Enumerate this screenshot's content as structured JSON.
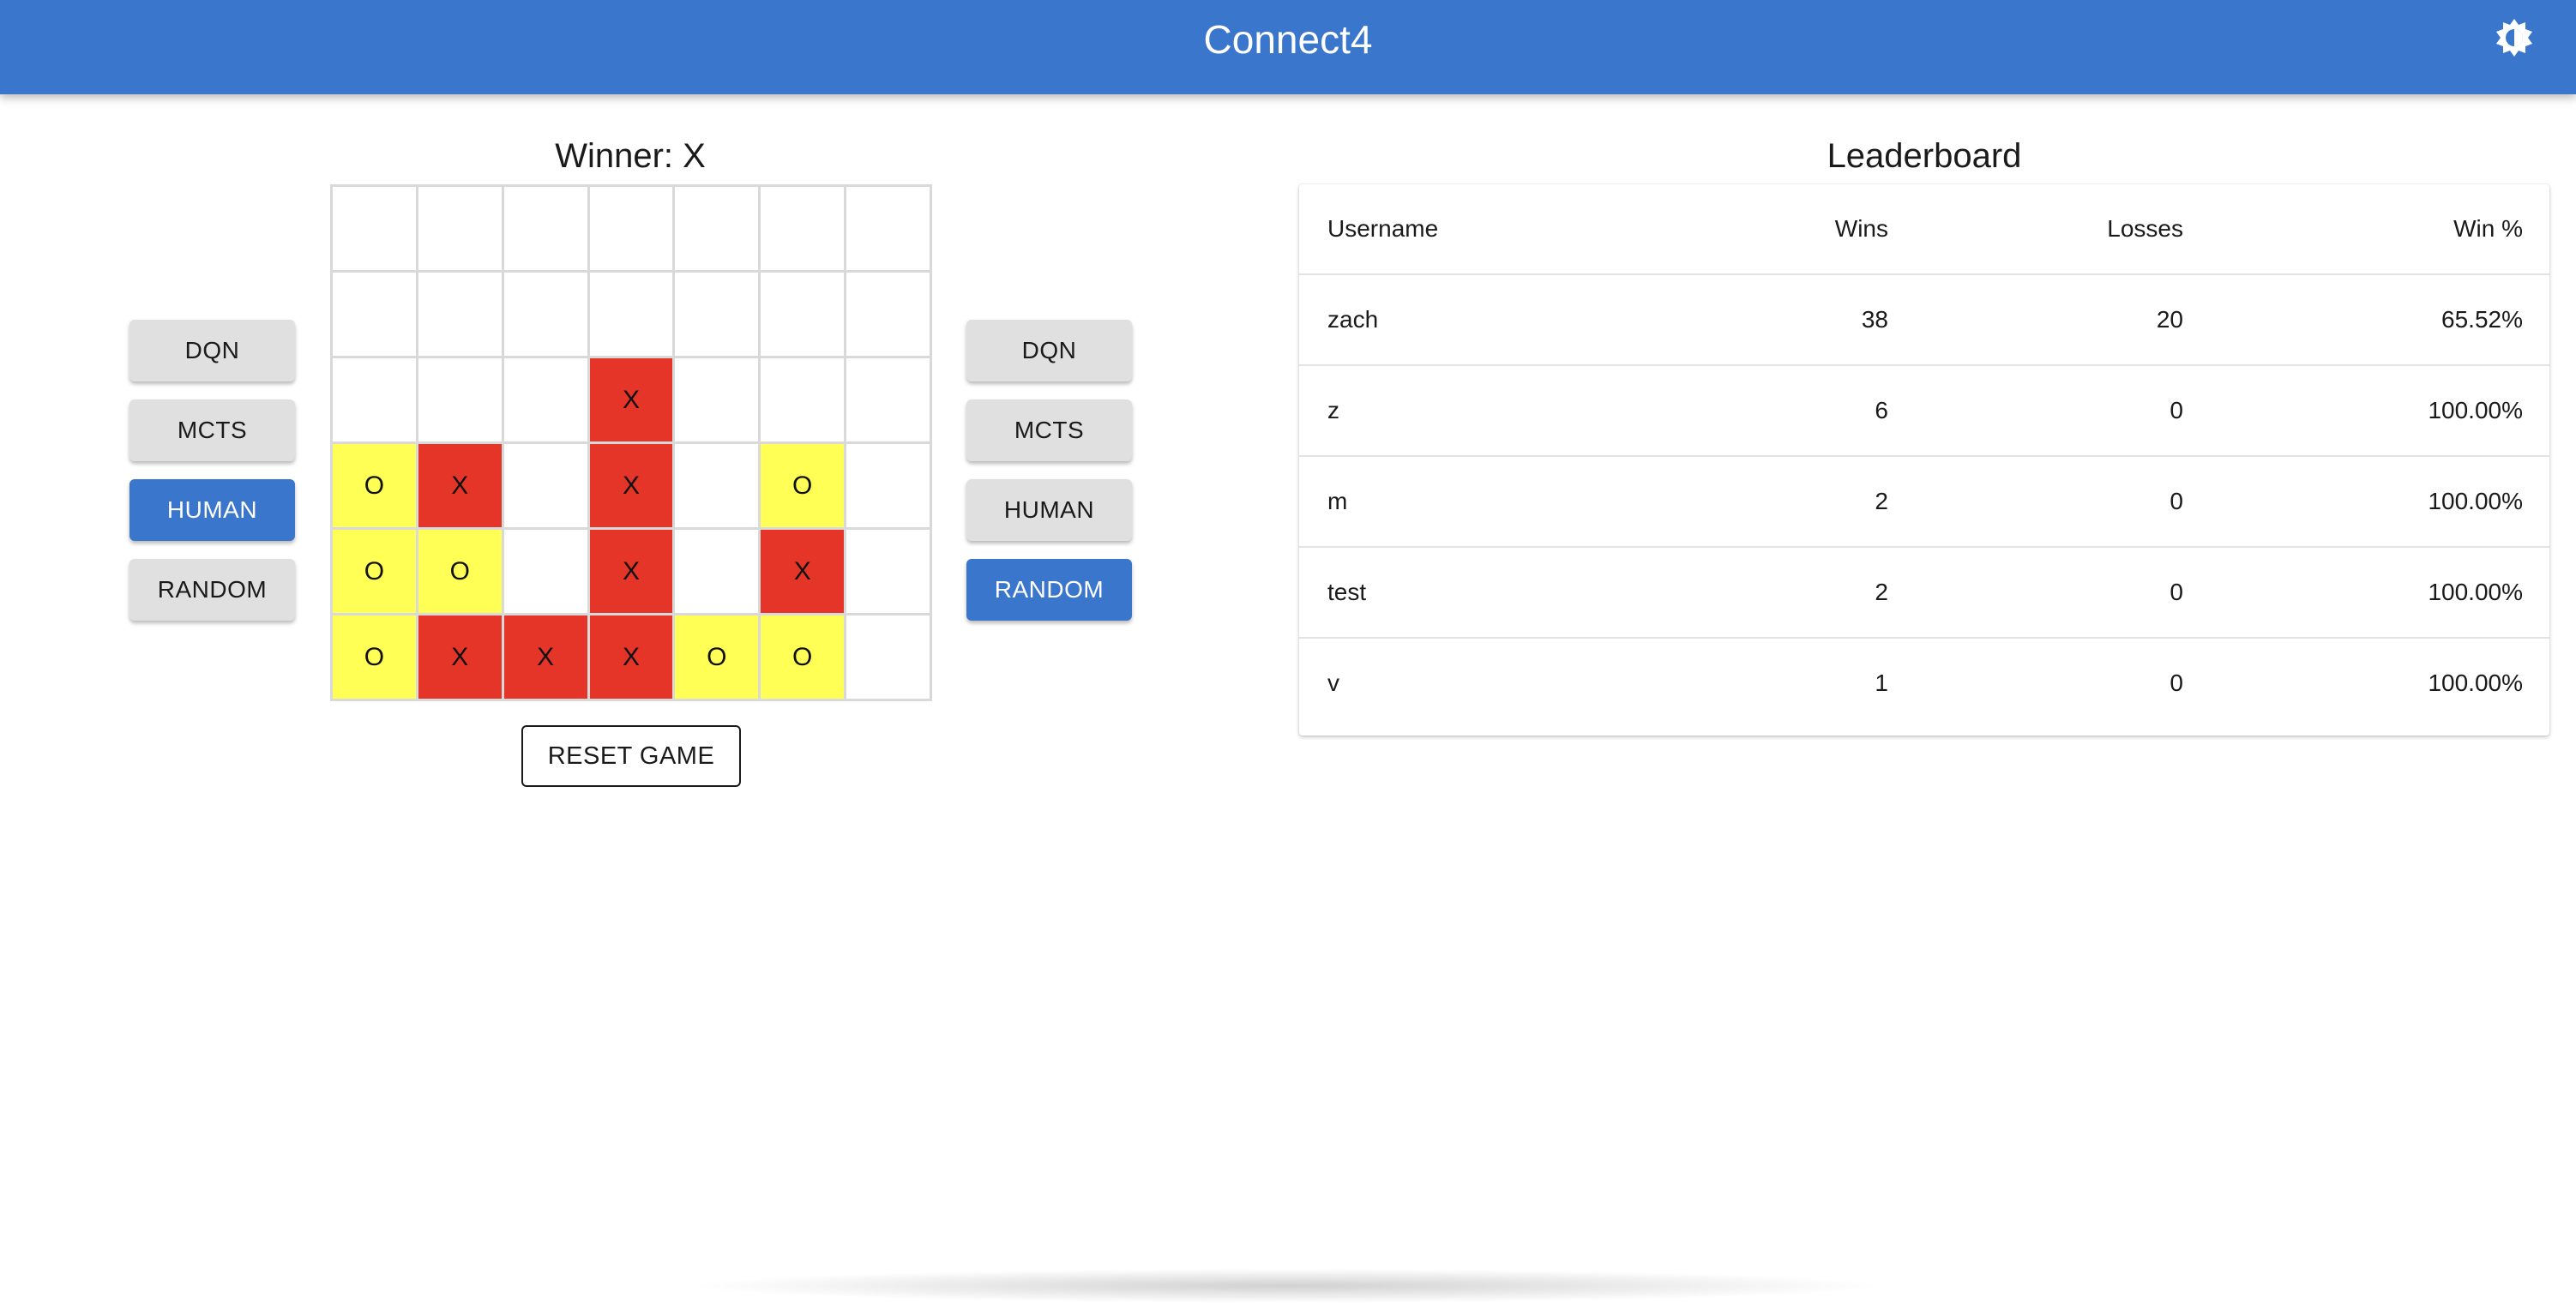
{
  "app": {
    "title": "Connect4",
    "theme_icon": "brightness-icon"
  },
  "game": {
    "status": "Winner: X",
    "board": [
      [
        "",
        "",
        "",
        "",
        "",
        "",
        ""
      ],
      [
        "",
        "",
        "",
        "",
        "",
        "",
        ""
      ],
      [
        "",
        "",
        "",
        "X",
        "",
        "",
        ""
      ],
      [
        "O",
        "X",
        "",
        "X",
        "",
        "O",
        ""
      ],
      [
        "O",
        "O",
        "",
        "X",
        "",
        "X",
        ""
      ],
      [
        "O",
        "X",
        "X",
        "X",
        "O",
        "O",
        ""
      ]
    ],
    "reset_label": "RESET GAME"
  },
  "players": {
    "left": {
      "options": [
        "DQN",
        "MCTS",
        "HUMAN",
        "RANDOM"
      ],
      "selected": "HUMAN"
    },
    "right": {
      "options": [
        "DQN",
        "MCTS",
        "HUMAN",
        "RANDOM"
      ],
      "selected": "RANDOM"
    }
  },
  "leaderboard": {
    "title": "Leaderboard",
    "headers": {
      "username": "Username",
      "wins": "Wins",
      "losses": "Losses",
      "win_pct": "Win %"
    },
    "rows": [
      {
        "username": "zach",
        "wins": "38",
        "losses": "20",
        "win_pct": "65.52%"
      },
      {
        "username": "z",
        "wins": "6",
        "losses": "0",
        "win_pct": "100.00%"
      },
      {
        "username": "m",
        "wins": "2",
        "losses": "0",
        "win_pct": "100.00%"
      },
      {
        "username": "test",
        "wins": "2",
        "losses": "0",
        "win_pct": "100.00%"
      },
      {
        "username": "v",
        "wins": "1",
        "losses": "0",
        "win_pct": "100.00%"
      }
    ]
  },
  "colors": {
    "primary": "#3a76cc",
    "x_piece": "#e53529",
    "o_piece": "#ffff55",
    "button_default": "#e0e0e0"
  }
}
